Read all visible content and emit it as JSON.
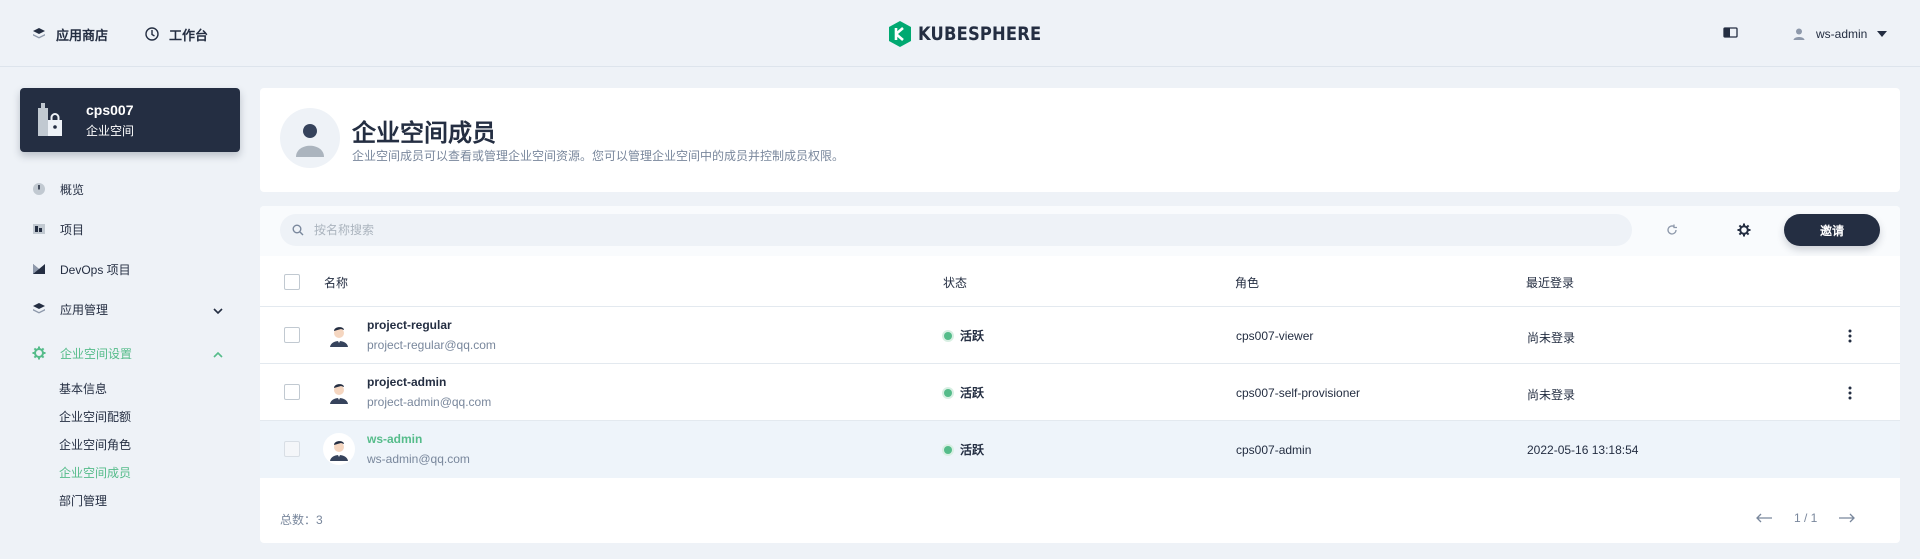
{
  "topbar": {
    "app_store": "应用商店",
    "workbench": "工作台",
    "logo_text": "KUBESPHERE",
    "user_name": "ws-admin"
  },
  "workspace": {
    "name": "cps007",
    "type": "企业空间"
  },
  "sidebar": {
    "items": [
      {
        "label": "概览",
        "icon": "dashboard-icon"
      },
      {
        "label": "项目",
        "icon": "project-icon"
      },
      {
        "label": "DevOps 项目",
        "icon": "devops-icon"
      },
      {
        "label": "应用管理",
        "icon": "app-icon"
      },
      {
        "label": "企业空间设置",
        "icon": "gear-icon"
      }
    ],
    "settings_subitems": [
      "基本信息",
      "企业空间配额",
      "企业空间角色",
      "企业空间成员",
      "部门管理"
    ]
  },
  "header": {
    "title": "企业空间成员",
    "description": "企业空间成员可以查看或管理企业空间资源。您可以管理企业空间中的成员并控制成员权限。"
  },
  "toolbar": {
    "search_placeholder": "按名称搜索",
    "invite_label": "邀请"
  },
  "table": {
    "columns": [
      "名称",
      "状态",
      "角色",
      "最近登录"
    ],
    "rows": [
      {
        "name": "project-regular",
        "email": "project-regular@qq.com",
        "status": "活跃",
        "role": "cps007-viewer",
        "last_login": "尚未登录"
      },
      {
        "name": "project-admin",
        "email": "project-admin@qq.com",
        "status": "活跃",
        "role": "cps007-self-provisioner",
        "last_login": "尚未登录"
      },
      {
        "name": "ws-admin",
        "email": "ws-admin@qq.com",
        "status": "活跃",
        "role": "cps007-admin",
        "last_login": "2022-05-16 13:18:54"
      }
    ]
  },
  "footer": {
    "total": "总数：3",
    "page": "1 / 1"
  },
  "colors": {
    "accent": "#55bc8a",
    "dark": "#242e42",
    "background": "#eef2f7"
  }
}
